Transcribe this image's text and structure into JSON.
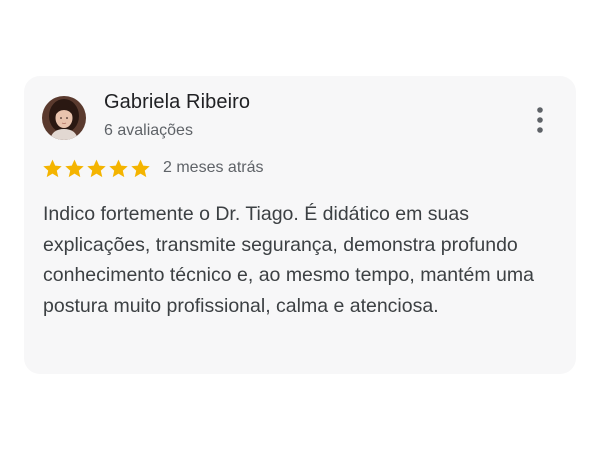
{
  "review": {
    "author": "Gabriela Ribeiro",
    "review_count": "6 avaliações",
    "rating": 5,
    "rating_max": 5,
    "time": "2 meses atrás",
    "text": "Indico fortemente o Dr. Tiago. É didático em suas explicações, transmite segurança, demonstra profundo conhecimento técnico e, ao mesmo tempo, mantém uma postura muito profissional, calma e atenciosa."
  },
  "icons": {
    "more": "more-vertical-icon",
    "star": "star-icon"
  },
  "colors": {
    "card_background": "#f7f7f8",
    "star": "#f4b400",
    "name": "#202124",
    "secondary_text": "#5f6368",
    "body_text": "#3c4043"
  }
}
